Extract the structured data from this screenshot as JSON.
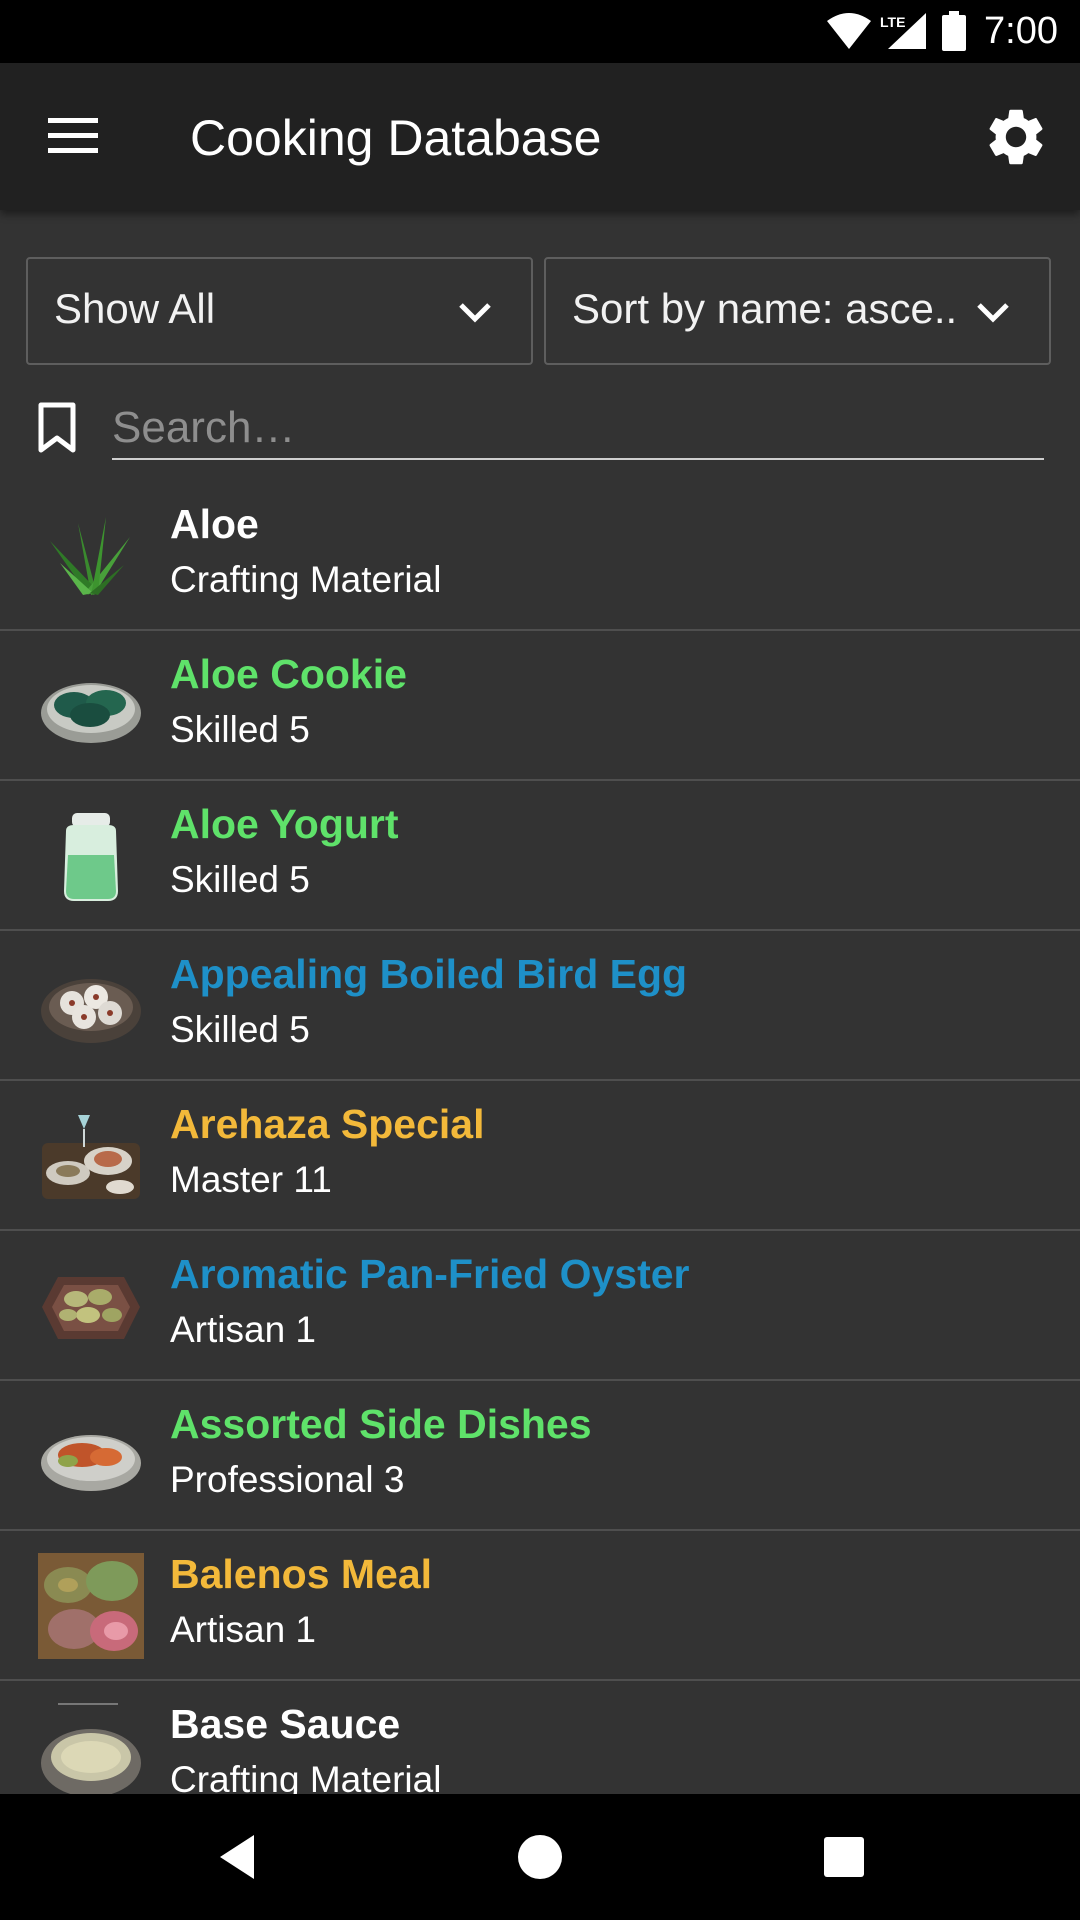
{
  "status_bar": {
    "time": "7:00",
    "network": "LTE",
    "icons": [
      "wifi-icon",
      "lte-signal-icon",
      "battery-icon"
    ]
  },
  "app_bar": {
    "title": "Cooking Database",
    "icons": [
      "menu-icon",
      "gear-icon"
    ]
  },
  "filters": {
    "category": "Show All",
    "sort": "Sort by name: asce.."
  },
  "search": {
    "placeholder": "Search…",
    "value": ""
  },
  "colors": {
    "white": "#ffffff",
    "green": "#5fe26a",
    "blue": "#1e90c8",
    "gold": "#f3b93a"
  },
  "items": [
    {
      "name": "Aloe",
      "subtitle": "Crafting Material",
      "color": "#ffffff",
      "icon": "aloe-plant-icon"
    },
    {
      "name": "Aloe Cookie",
      "subtitle": "Skilled 5",
      "color": "#5fe26a",
      "icon": "cookie-plate-icon"
    },
    {
      "name": "Aloe Yogurt",
      "subtitle": "Skilled 5",
      "color": "#5fe26a",
      "icon": "yogurt-jar-icon"
    },
    {
      "name": "Appealing Boiled Bird Egg",
      "subtitle": "Skilled 5",
      "color": "#1e90c8",
      "icon": "boiled-egg-plate-icon"
    },
    {
      "name": "Arehaza Special",
      "subtitle": "Master 11",
      "color": "#f3b93a",
      "icon": "special-meal-icon"
    },
    {
      "name": "Aromatic Pan-Fried Oyster",
      "subtitle": "Artisan 1",
      "color": "#1e90c8",
      "icon": "oyster-plate-icon"
    },
    {
      "name": "Assorted Side Dishes",
      "subtitle": "Professional 3",
      "color": "#5fe26a",
      "icon": "side-dish-plate-icon"
    },
    {
      "name": "Balenos Meal",
      "subtitle": "Artisan 1",
      "color": "#f3b93a",
      "icon": "balenos-meal-icon"
    },
    {
      "name": "Base Sauce",
      "subtitle": "Crafting Material",
      "color": "#ffffff",
      "icon": "sauce-pot-icon"
    }
  ],
  "nav_bar": {
    "icons": [
      "back-icon",
      "home-icon",
      "recents-icon"
    ]
  }
}
